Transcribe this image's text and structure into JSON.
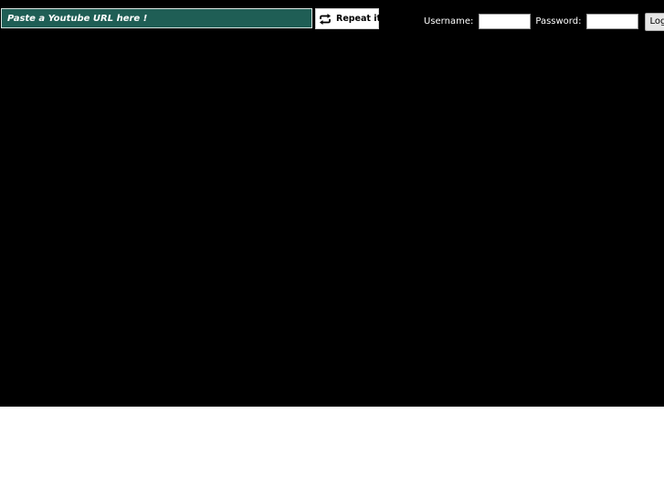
{
  "player": {
    "url_placeholder": "Paste a Youtube URL here !",
    "url_value": "",
    "repeat_label": "Repeat it!",
    "repeat_icon": "repeat-icon"
  },
  "login": {
    "username_label": "Username:",
    "username_value": "",
    "password_label": "Password:",
    "password_value": "",
    "submit_label": "Login"
  },
  "colors": {
    "stage_background": "#000000",
    "url_field_background": "#1f5e55",
    "page_background": "#ffffff"
  }
}
